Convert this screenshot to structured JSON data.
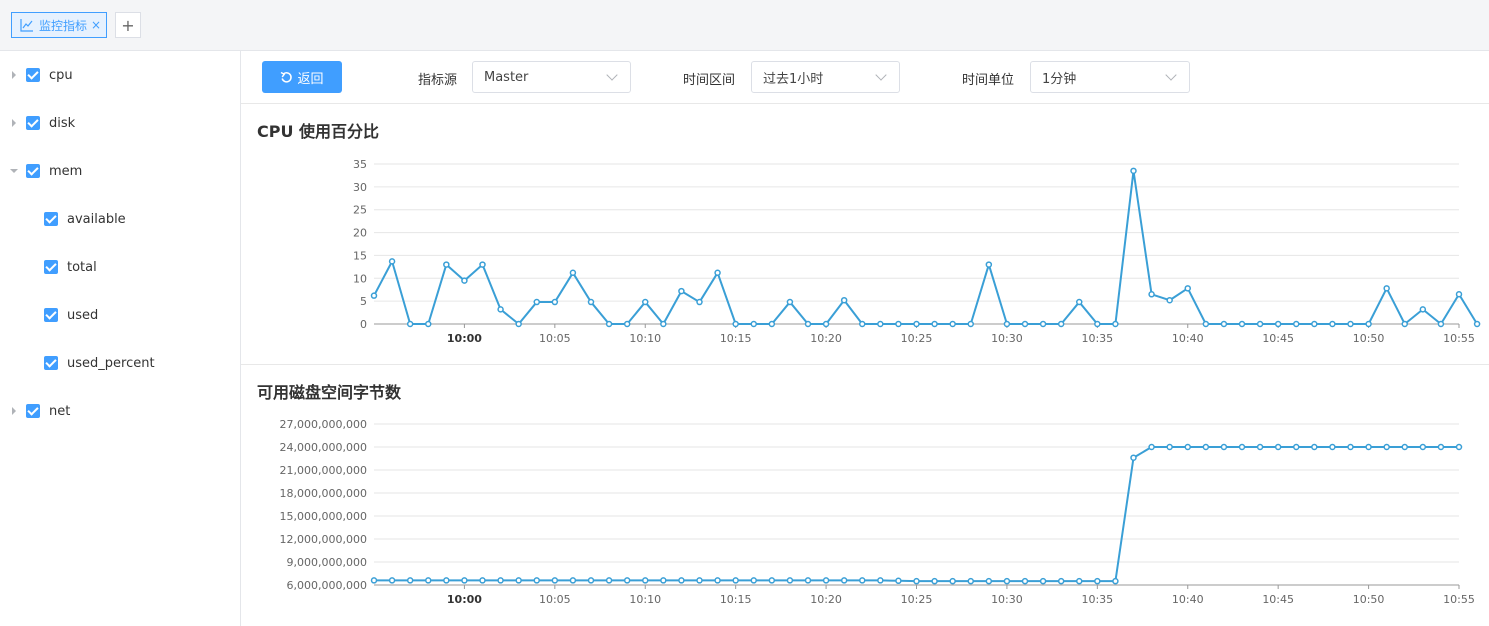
{
  "tabs": {
    "active_label": "监控指标",
    "close": "×",
    "add": "+"
  },
  "sidebar": {
    "items": [
      {
        "label": "cpu",
        "expanded": false,
        "checked": true
      },
      {
        "label": "disk",
        "expanded": false,
        "checked": true
      },
      {
        "label": "mem",
        "expanded": true,
        "checked": true
      },
      {
        "label": "available",
        "checked": true
      },
      {
        "label": "total",
        "checked": true
      },
      {
        "label": "used",
        "checked": true
      },
      {
        "label": "used_percent",
        "checked": true
      },
      {
        "label": "net",
        "expanded": false,
        "checked": true
      }
    ]
  },
  "toolbar": {
    "back_label": "返回",
    "source_label": "指标源",
    "source_value": "Master",
    "range_label": "时间区间",
    "range_value": "过去1小时",
    "unit_label": "时间单位",
    "unit_value": "1分钟"
  },
  "colors": {
    "accent": "#409eff",
    "series": "#3a9fd6"
  },
  "chart_data": [
    {
      "type": "line",
      "title": "CPU 使用百分比",
      "x_ticks": [
        "10:00",
        "10:05",
        "10:10",
        "10:15",
        "10:20",
        "10:25",
        "10:30",
        "10:35",
        "10:40",
        "10:45",
        "10:50",
        "10:55"
      ],
      "x_start": "09:55",
      "x_end": "10:55",
      "x_step_minutes": 1,
      "ylim": [
        0,
        35
      ],
      "y_ticks": [
        "0",
        "5",
        "10",
        "15",
        "20",
        "25",
        "30",
        "35"
      ],
      "grid": true,
      "series": [
        {
          "values": [
            6.2,
            13.7,
            0,
            0,
            13,
            9.5,
            13,
            3.2,
            0,
            4.8,
            4.8,
            11.2,
            4.8,
            0,
            0,
            4.8,
            0,
            7.2,
            4.8,
            11.2,
            0,
            0,
            0,
            4.8,
            0,
            0,
            5.2,
            0,
            0,
            0,
            0,
            0,
            0,
            0,
            13,
            0,
            0,
            0,
            0,
            4.8,
            0,
            0,
            33.5,
            6.5,
            5.2,
            7.8,
            0,
            0,
            0,
            0,
            0,
            0,
            0,
            0,
            0,
            0,
            7.8,
            0,
            3.2,
            0,
            6.5,
            0
          ]
        }
      ]
    },
    {
      "type": "line",
      "title": "可用磁盘空间字节数",
      "x_ticks": [
        "10:00",
        "10:05",
        "10:10",
        "10:15",
        "10:20",
        "10:25",
        "10:30",
        "10:35",
        "10:40",
        "10:45",
        "10:50",
        "10:55"
      ],
      "x_start": "09:55",
      "x_end": "10:55",
      "x_step_minutes": 1,
      "ylim": [
        6000000000,
        27000000000
      ],
      "y_ticks": [
        "6,000,000,000",
        "9,000,000,000",
        "12,000,000,000",
        "15,000,000,000",
        "18,000,000,000",
        "21,000,000,000",
        "24,000,000,000",
        "27,000,000,000"
      ],
      "grid": true,
      "series": [
        {
          "values": [
            6600000000,
            6600000000,
            6600000000,
            6600000000,
            6600000000,
            6600000000,
            6600000000,
            6600000000,
            6600000000,
            6600000000,
            6600000000,
            6600000000,
            6600000000,
            6600000000,
            6600000000,
            6600000000,
            6600000000,
            6600000000,
            6600000000,
            6600000000,
            6600000000,
            6600000000,
            6600000000,
            6600000000,
            6600000000,
            6600000000,
            6600000000,
            6600000000,
            6600000000,
            6550000000,
            6500000000,
            6500000000,
            6500000000,
            6500000000,
            6500000000,
            6500000000,
            6500000000,
            6500000000,
            6500000000,
            6500000000,
            6500000000,
            6500000000,
            22600000000,
            24000000000,
            24000000000,
            24000000000,
            24000000000,
            24000000000,
            24000000000,
            24000000000,
            24000000000,
            24000000000,
            24000000000,
            24000000000,
            24000000000,
            24000000000,
            24000000000,
            24000000000,
            24000000000,
            24000000000,
            24000000000
          ]
        }
      ]
    }
  ]
}
